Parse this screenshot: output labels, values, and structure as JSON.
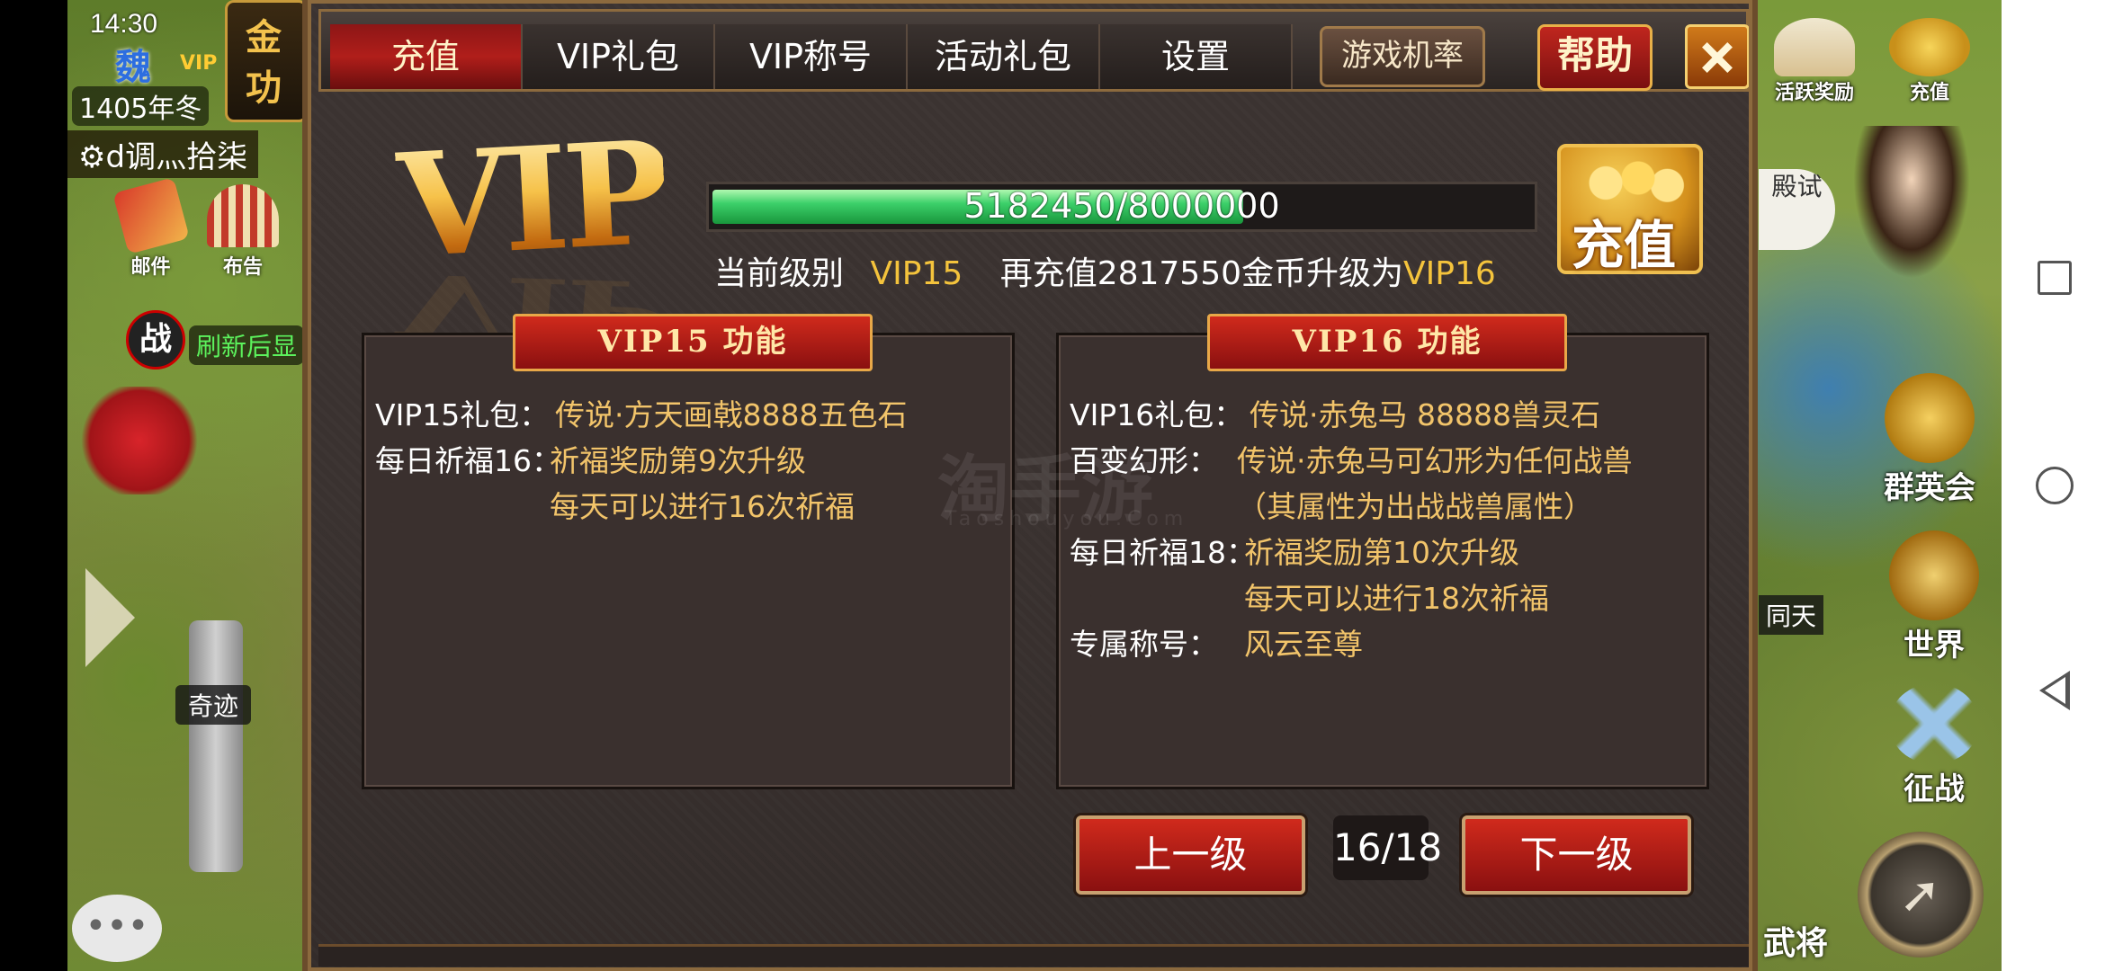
{
  "hud_left": {
    "time": "14:30",
    "kingdom": "魏",
    "vip_badge": "VIP",
    "year": "1405年冬",
    "tab_chars": [
      "金",
      "功"
    ],
    "notice": "d调灬拾柒",
    "mail_label": "邮件",
    "bulletin_label": "布告",
    "battle_char": "战",
    "refresh_label": "刷新后显",
    "miracle_label": "奇迹",
    "chat_glyph": "•••"
  },
  "hud_right": {
    "active_reward": "活跃奖励",
    "recharge": "充值",
    "trial": "殿试",
    "heroes": "群英会",
    "world": "世界",
    "tongtian": "同天",
    "campaign": "征战",
    "generals": "武将"
  },
  "dialog": {
    "tabs": [
      "充值",
      "VIP礼包",
      "VIP称号",
      "活动礼包",
      "设置"
    ],
    "active_tab": 0,
    "odds_button": "游戏机率",
    "help_button": "帮助",
    "vip_logo": "VIP",
    "progress": {
      "current": 5182450,
      "target": 8000000,
      "text": "5182450/8000000"
    },
    "status": {
      "level_label": "当前级别",
      "level_value": "VIP15",
      "recharge_prefix": "再充值2817550金币升级为",
      "next_level": "VIP16"
    },
    "recharge_button": "充值",
    "current_panel": {
      "title": "VIP15  功能",
      "rows": [
        {
          "label": "VIP15礼包：",
          "value": "传说·方天画戟8888五色石"
        },
        {
          "label": "每日祈福16：",
          "value": "祈福奖励第9次升级"
        },
        {
          "label": "",
          "value": "每天可以进行16次祈福"
        }
      ]
    },
    "next_panel": {
      "title": "VIP16  功能",
      "rows": [
        {
          "label": "VIP16礼包：",
          "value": "传说·赤兔马 88888兽灵石"
        },
        {
          "label": "百变幻形：",
          "value": "传说·赤兔马可幻形为任何战兽"
        },
        {
          "label": "",
          "value": "（其属性为出战战兽属性）"
        },
        {
          "label": "每日祈福18：",
          "value": "祈福奖励第10次升级"
        },
        {
          "label": "",
          "value": "每天可以进行18次祈福"
        },
        {
          "label": "专属称号：",
          "value": "风云至尊"
        }
      ]
    },
    "prev_button": "上一级",
    "next_button": "下一级",
    "page": "16/18"
  },
  "watermark": {
    "main": "淘手游",
    "sub": "Taoshouyou.Com"
  },
  "colors": {
    "gold_text": "#f4c33c",
    "tab_active": "#b01e1a",
    "progress_green": "#3cd06a"
  }
}
